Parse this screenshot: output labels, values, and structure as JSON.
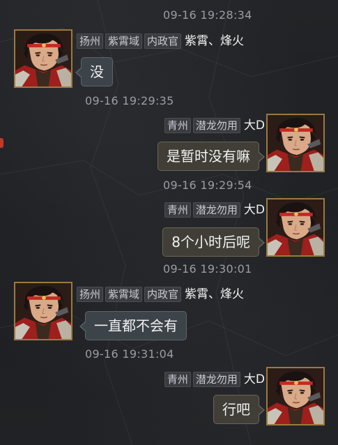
{
  "messages": [
    {
      "id": "m1",
      "side": "left",
      "time": "09-16 19:28:34",
      "tags": [
        "扬州",
        "紫霄域",
        "内政官"
      ],
      "nick": "紫霄、烽火",
      "text": "没"
    },
    {
      "id": "m2",
      "side": "right",
      "time": "09-16 19:29:35",
      "tags": [
        "青州",
        "潜龙勿用"
      ],
      "nick": "大D",
      "text": "是暂时没有嘛"
    },
    {
      "id": "m3",
      "side": "right",
      "time": "09-16 19:29:54",
      "tags": [
        "青州",
        "潜龙勿用"
      ],
      "nick": "大D",
      "text": "8个小时后呢"
    },
    {
      "id": "m4",
      "side": "left",
      "time": "09-16 19:30:01",
      "tags": [
        "扬州",
        "紫霄域",
        "内政官"
      ],
      "nick": "紫霄、烽火",
      "text": "一直都不会有"
    },
    {
      "id": "m5",
      "side": "right",
      "time": "09-16 19:31:04",
      "tags": [
        "青州",
        "潜龙勿用"
      ],
      "nick": "大D",
      "text": "行吧"
    }
  ],
  "colors": {
    "background": "#1f2023",
    "bubble_left": "#3d4449",
    "bubble_right": "#403e37",
    "avatar_border": "#9b7a3f",
    "timestamp": "#9a9da3"
  },
  "icons": {
    "avatar": "warrior-portrait-icon",
    "edge_marker": "notification-dot-icon"
  }
}
